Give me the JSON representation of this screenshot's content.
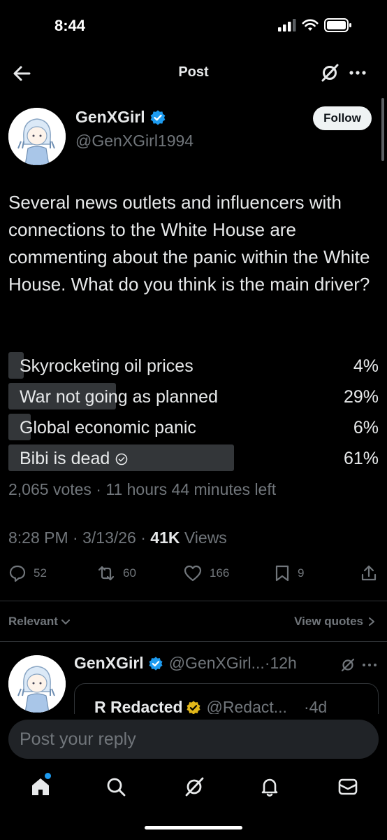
{
  "status_bar": {
    "time": "8:44"
  },
  "nav": {
    "title": "Post",
    "back_icon": "arrow-left-icon",
    "grok_icon": "grok-icon",
    "more_icon": "more-icon"
  },
  "author": {
    "name": "GenXGirl",
    "handle": "@GenXGirl1994",
    "verified": true,
    "follow_label": "Follow"
  },
  "post": {
    "text": "Several news outlets and influencers with connections to the White House are commenting about the panic within the White House. What do you think is the main driver?",
    "timestamp": "8:28 PM · 3/13/26 · ",
    "views_count": "41K",
    "views_label": " Views"
  },
  "poll": {
    "options": [
      {
        "label": "Skyrocketing oil prices",
        "pct_label": "4%",
        "value": 4,
        "winner": false
      },
      {
        "label": "War not going as planned",
        "pct_label": "29%",
        "value": 29,
        "winner": false
      },
      {
        "label": "Global economic panic",
        "pct_label": "6%",
        "value": 6,
        "winner": false
      },
      {
        "label": "Bibi is dead",
        "pct_label": "61%",
        "value": 61,
        "winner": true
      }
    ],
    "meta": "2,065 votes · 11 hours 44 minutes left"
  },
  "actions": {
    "replies": "52",
    "reposts": "60",
    "likes": "166",
    "bookmarks": "9"
  },
  "sort": {
    "relevant": "Relevant",
    "view_quotes": "View quotes"
  },
  "reply": {
    "name": "GenXGirl",
    "handle": "@GenXGirl...",
    "time": "·12h",
    "quote": {
      "name": "R Redacted",
      "handle": "@Redact...",
      "time": "·4d"
    }
  },
  "composer": {
    "placeholder": "Post your reply"
  },
  "tabs": [
    "home-icon",
    "search-icon",
    "grok-icon",
    "notifications-icon",
    "messages-icon"
  ],
  "colors": {
    "accent": "#1d9bf0",
    "verified_gold": "#e2b719",
    "bar": "#333639",
    "muted": "#71767b"
  }
}
